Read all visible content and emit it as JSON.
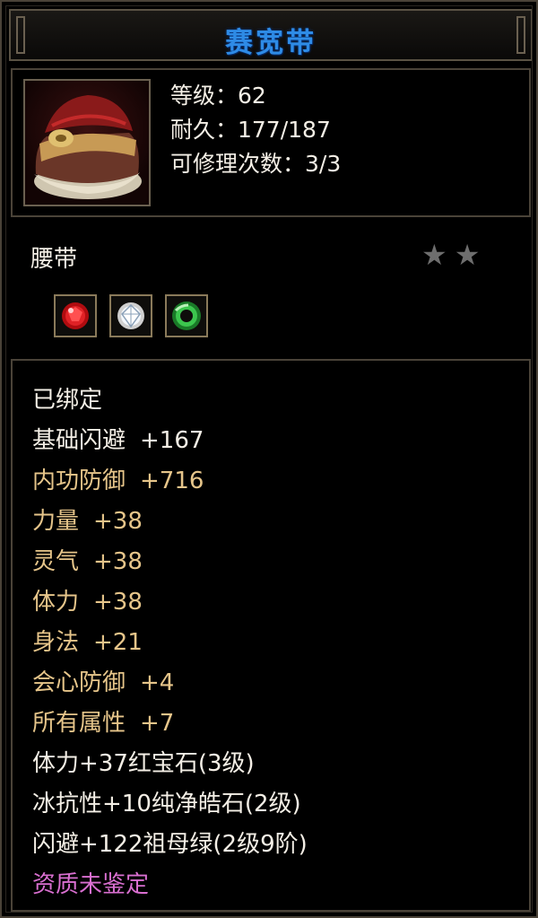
{
  "item": {
    "name": "赛宽带",
    "level_line": "等级：62",
    "durability_line": "耐久：177/187",
    "repair_line": "可修理次数：3/3",
    "type": "腰带",
    "star_count": 2
  },
  "gems": [
    {
      "icon": "ruby-gem-icon",
      "color": "#d01a1a"
    },
    {
      "icon": "diamond-gem-icon",
      "color": "#dfe8f0"
    },
    {
      "icon": "emerald-gem-icon",
      "color": "#2aa83a"
    }
  ],
  "attributes": {
    "bound": "已绑定",
    "list": [
      {
        "name": "基础闪避",
        "value": "+167",
        "style": "white"
      },
      {
        "name": "内功防御",
        "value": "+716",
        "style": "gold"
      },
      {
        "name": "力量",
        "value": "+38",
        "style": "gold"
      },
      {
        "name": "灵气",
        "value": "+38",
        "style": "gold"
      },
      {
        "name": "体力",
        "value": "+38",
        "style": "gold"
      },
      {
        "name": "身法",
        "value": "+21",
        "style": "gold"
      },
      {
        "name": "会心防御",
        "value": "+4",
        "style": "gold"
      },
      {
        "name": "所有属性",
        "value": "+7",
        "style": "gold"
      }
    ],
    "gem_lines": [
      "体力+37红宝石(3级)",
      "冰抗性+10纯净皓石(2级)",
      "闪避+122祖母绿(2级9阶)"
    ],
    "quality": "资质未鉴定"
  },
  "colors": {
    "title": "#2e8be6",
    "white_text": "#f4efe6",
    "gold_text": "#e6c58a",
    "pink_text": "#d96fd0",
    "star_inactive": "#6e6e6e",
    "border": "#4a4338"
  }
}
